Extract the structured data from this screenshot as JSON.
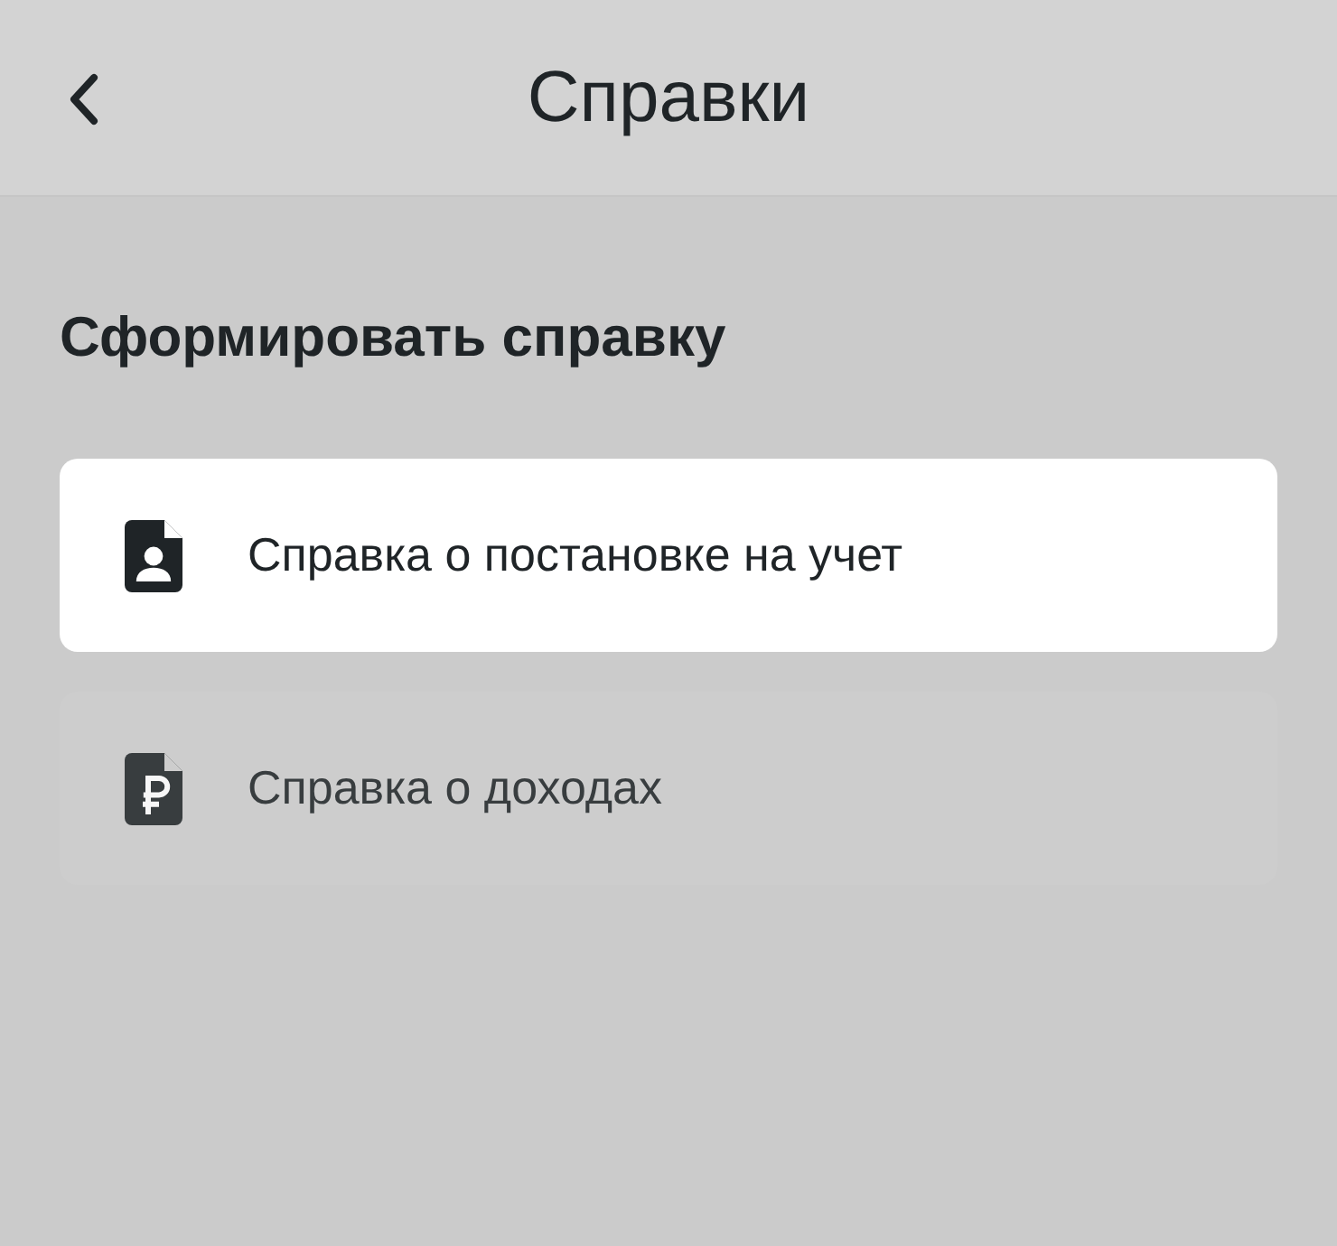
{
  "header": {
    "title": "Справки"
  },
  "section_title": "Сформировать справку",
  "items": [
    {
      "kind": "person",
      "label": "Справка о постановке на учет",
      "highlighted": true
    },
    {
      "kind": "ruble",
      "label": "Справка о доходах",
      "highlighted": false
    }
  ]
}
